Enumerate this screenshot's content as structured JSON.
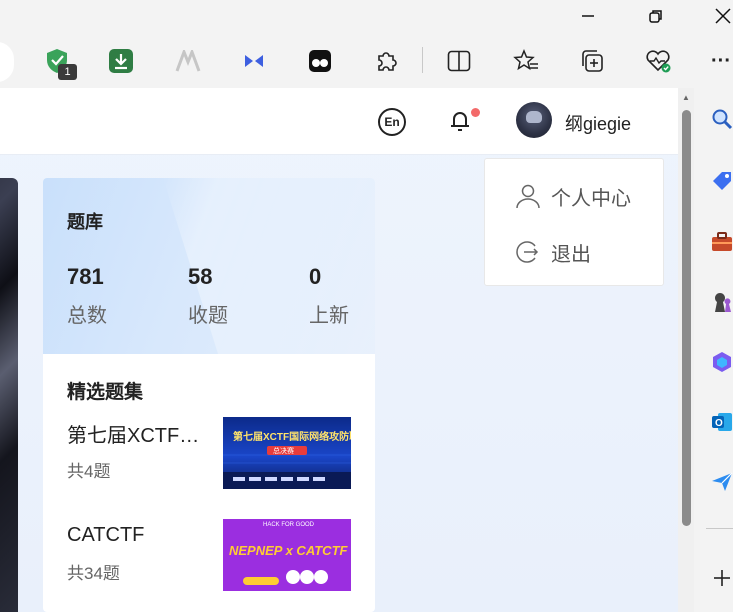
{
  "browser": {
    "extension_badge": "1",
    "tool_icons": [
      "shield-extension-icon",
      "download-extension-icon",
      "logo-extension-icon",
      "bow-tie-extension-icon",
      "face-extension-icon",
      "extensions-puzzle-icon",
      "split-screen-icon",
      "favorites-icon",
      "collections-icon",
      "browser-essentials-icon",
      "more-icon"
    ],
    "sidebar_icons": [
      "search-icon",
      "shopping-tag-icon",
      "tools-briefcase-icon",
      "games-chess-icon",
      "copilot-icon",
      "outlook-icon",
      "send-icon",
      "add-icon"
    ],
    "more_label": "···"
  },
  "header": {
    "lang_label": "En",
    "username": "纲giegie"
  },
  "library": {
    "title": "题库",
    "stats": [
      {
        "value": "781",
        "label": "总数"
      },
      {
        "value": "58",
        "label": "收题"
      },
      {
        "value": "0",
        "label": "上新"
      }
    ]
  },
  "featured": {
    "title": "精选题集",
    "items": [
      {
        "title": "第七届XCTF…",
        "count": "共4题",
        "thumb_text": "第七届XCTF国际网络攻防联赛",
        "thumb_sub": "总决赛"
      },
      {
        "title": "CATCTF",
        "count": "共34题",
        "thumb_text": "NEPNEP x CATCTF",
        "thumb_sub": "HACK FOR GOOD"
      }
    ]
  },
  "dropdown": {
    "items": [
      {
        "label": "个人中心",
        "icon": "user-icon"
      },
      {
        "label": "退出",
        "icon": "logout-icon"
      }
    ]
  },
  "colors": {
    "accent_blue": "#c9e0fb",
    "notification_dot": "#f36a6a",
    "thumb_blue": "#1a46c9",
    "thumb_purple": "#9b2ee0"
  }
}
